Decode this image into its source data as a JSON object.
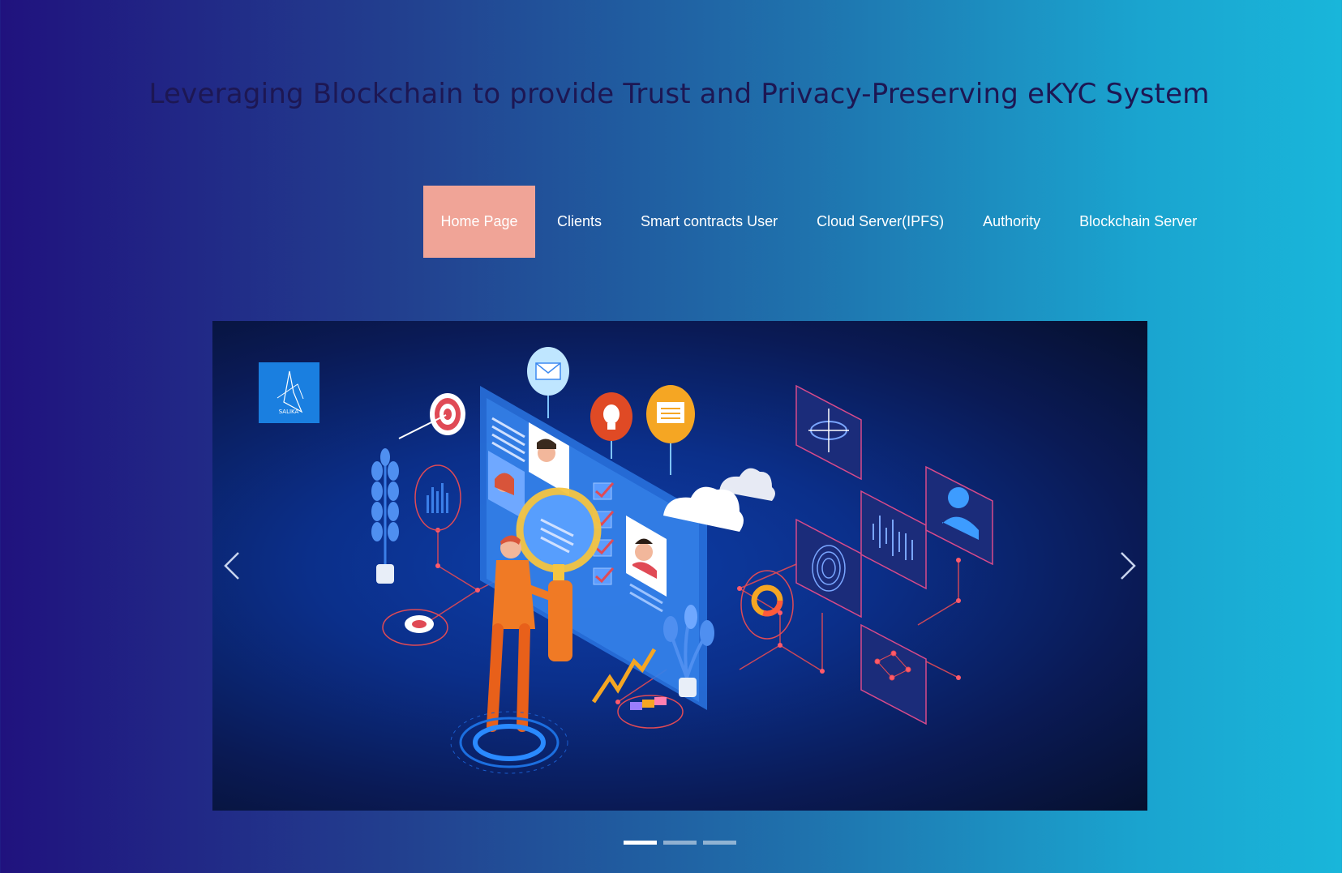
{
  "header": {
    "title": "Leveraging Blockchain to provide Trust and Privacy-Preserving eKYC System"
  },
  "nav": {
    "items": [
      {
        "label": "Home Page",
        "active": true
      },
      {
        "label": "Clients"
      },
      {
        "label": "Smart contracts User"
      },
      {
        "label": "Cloud Server(IPFS)"
      },
      {
        "label": "Authority"
      },
      {
        "label": "Blockchain Server"
      }
    ]
  },
  "carousel": {
    "logo_text": "SALIKA",
    "slide_count": 3,
    "active_slide": 1,
    "prev_icon": "chevron-left-icon",
    "next_icon": "chevron-right-icon"
  },
  "colors": {
    "active_nav": "#f0a497",
    "title": "#1d1753",
    "background_start": "#20127e",
    "background_end": "#19b6da"
  }
}
